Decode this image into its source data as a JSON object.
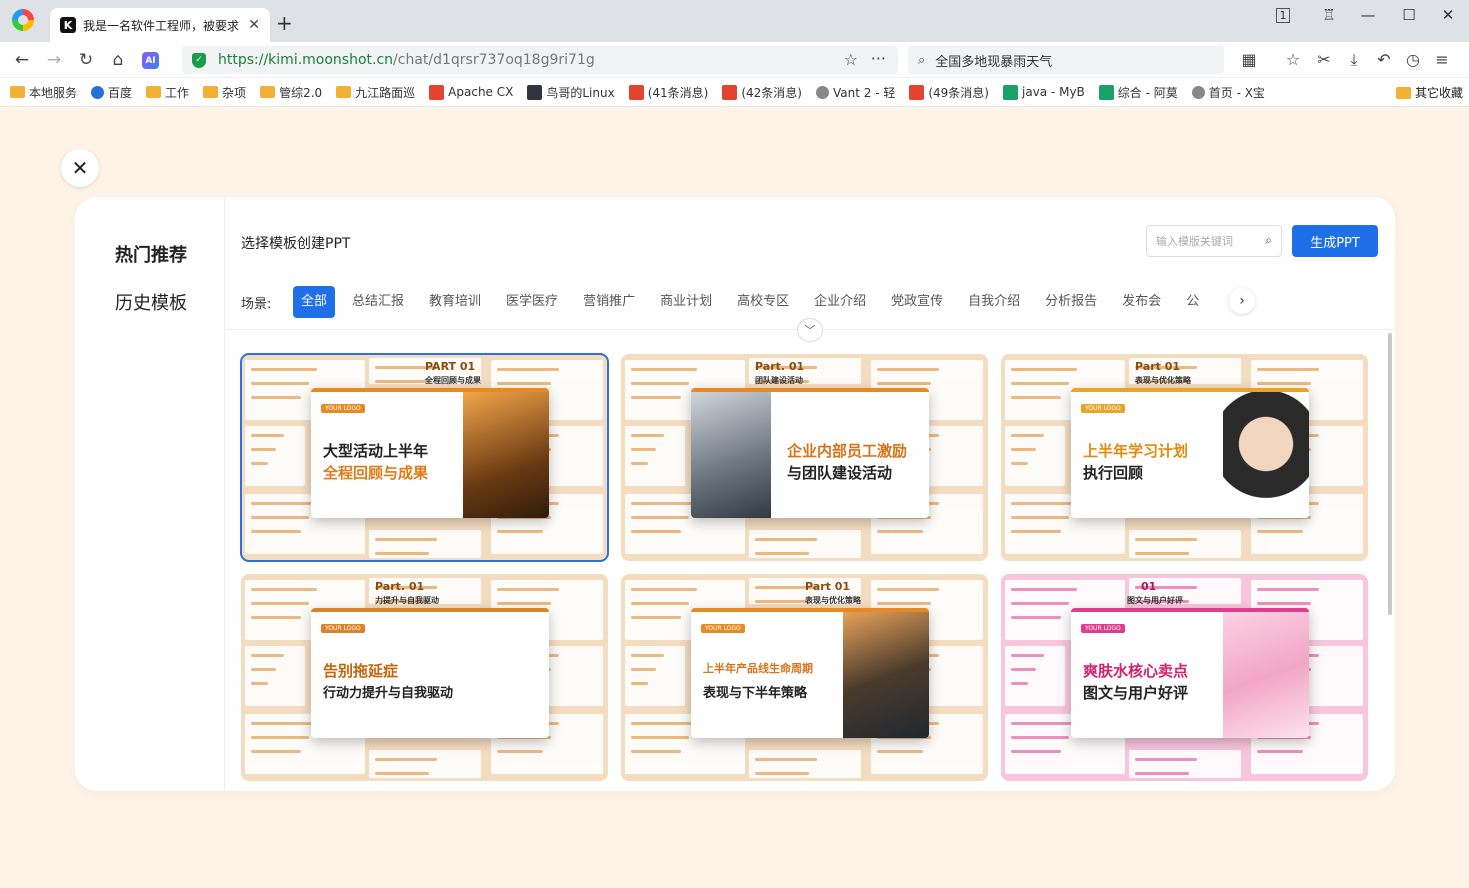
{
  "browser": {
    "tab_title": "我是一名软件工程师，被要求",
    "tab_favicon": "K",
    "url_host": "https://kimi.moonshot.cn",
    "url_path": "/chat/d1qrsr737oq18g9ri71g",
    "search_text": "全国多地现暴雨天气",
    "ai_label": "AI",
    "shield_mark": "✓",
    "tab_counter": "1",
    "icons": {
      "search": "⌕",
      "star": "☆",
      "more": "···",
      "grid": "▦",
      "favorites": "☆",
      "scissors": "✂",
      "download": "⤓",
      "undo": "↶",
      "history": "◷",
      "menu": "≡",
      "back": "←",
      "forward": "→",
      "refresh": "↻",
      "home": "⌂",
      "minimize": "—",
      "maximize": "☐",
      "close": "✕",
      "skin": "♖",
      "new_tab": "+"
    },
    "bookmarks": [
      {
        "label": "本地服务",
        "type": "folder"
      },
      {
        "label": "百度",
        "type": "blue"
      },
      {
        "label": "工作",
        "type": "folder"
      },
      {
        "label": "杂项",
        "type": "folder"
      },
      {
        "label": "管综2.0",
        "type": "folder"
      },
      {
        "label": "九江路面巡",
        "type": "folder"
      },
      {
        "label": "Apache CX",
        "type": "red"
      },
      {
        "label": "鸟哥的Linux",
        "type": "dark"
      },
      {
        "label": "(41条消息)",
        "type": "red"
      },
      {
        "label": "(42条消息)",
        "type": "red"
      },
      {
        "label": "Vant 2 - 轻",
        "type": "grey"
      },
      {
        "label": "(49条消息)",
        "type": "red"
      },
      {
        "label": "java - MyB",
        "type": "green"
      },
      {
        "label": "综合 - 阿莫",
        "type": "green"
      },
      {
        "label": "首页 - X宝",
        "type": "grey"
      }
    ],
    "other_bookmarks": "其它收藏"
  },
  "modal": {
    "close_icon": "✕",
    "sidebar": [
      {
        "label": "热门推荐",
        "active": true
      },
      {
        "label": "历史模板",
        "active": false
      }
    ],
    "title": "选择模板创建PPT",
    "search_placeholder": "输入模版关键词",
    "generate_button": "生成PPT",
    "scene_label": "场景:",
    "categories": [
      "全部",
      "总结汇报",
      "教育培训",
      "医学医疗",
      "营销推广",
      "商业计划",
      "高校专区",
      "企业介绍",
      "党政宣传",
      "自我介绍",
      "分析报告",
      "发布会",
      "公"
    ],
    "active_category": "全部",
    "next_icon": "›",
    "expand_icon": "﹀",
    "templates": [
      {
        "part": "PART 01",
        "part_sub": "全程回顾与成果",
        "logo": "YOUR LOGO",
        "line1": "大型活动上半年",
        "line2": "全程回顾与成果",
        "accent": "#e88a24",
        "line2_color": "#e07b18",
        "selected": true,
        "image": "star-trophy"
      },
      {
        "part": "Part. 01",
        "part_sub": "团队建设活动",
        "logo": "",
        "line1": "企业内部员工激励",
        "line2": "与团队建设活动",
        "accent": "#e88a24",
        "line2_color": "#222",
        "selected": false,
        "image": "business-people"
      },
      {
        "part": "Part 01",
        "part_sub": "表现与优化策略",
        "logo": "YOUR LOGO",
        "line1": "上半年学习计划",
        "line2": "执行回顾",
        "accent": "#e9a52a",
        "line2_color": "#222",
        "selected": false,
        "image": "businesswoman"
      },
      {
        "part": "Part. 01",
        "part_sub": "力提升与自我驱动",
        "logo": "YOUR LOGO",
        "line1": "告别拖延症",
        "line2": "行动力提升与自我驱动",
        "accent": "#d9842a",
        "line2_color": "#222",
        "selected": false,
        "image": "gauge"
      },
      {
        "part": "Part 01",
        "part_sub": "表现与优化策略",
        "logo": "YOUR LOGO",
        "line1": "上半年产品线生命周期",
        "line2": "表现与下半年策略",
        "accent": "#e88a24",
        "line2_color": "#222",
        "selected": false,
        "image": "factory"
      },
      {
        "part": "01",
        "part_sub": "图文与用户好评",
        "logo": "YOUR LOGO",
        "line1": "爽肤水核心卖点",
        "line2": "图文与用户好评",
        "accent": "#e23d8a",
        "line2_color": "#222",
        "selected": false,
        "image": "cosmetic-bottle"
      }
    ]
  }
}
